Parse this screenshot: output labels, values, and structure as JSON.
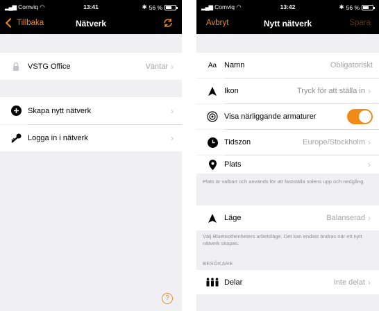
{
  "left": {
    "status": {
      "carrier": "Comviq",
      "time": "13:41",
      "battery": "56 %"
    },
    "nav": {
      "back_label": "Tillbaka",
      "title": "Nätverk",
      "refresh_icon": "refresh-icon"
    },
    "networks": [
      {
        "name": "VSTG Office",
        "status": "Väntar",
        "icon": "lock-icon"
      }
    ],
    "actions": [
      {
        "label": "Skapa nytt nätverk",
        "icon": "plus-circle-icon"
      },
      {
        "label": "Logga in i nätverk",
        "icon": "key-icon"
      }
    ],
    "help_label": "?"
  },
  "right": {
    "status": {
      "carrier": "Comviq",
      "time": "13:42",
      "battery": "56 %"
    },
    "nav": {
      "cancel_label": "Avbryt",
      "title": "Nytt nätverk",
      "save_label": "Spara"
    },
    "rows": {
      "name": {
        "label": "Namn",
        "placeholder": "Obligatoriskt",
        "icon_text": "Aa"
      },
      "icon": {
        "label": "Ikon",
        "value": "Tryck för att ställa in"
      },
      "nearby": {
        "label": "Visa närliggande armaturer",
        "enabled": true
      },
      "timezone": {
        "label": "Tidszon",
        "value": "Europe/Stockholm"
      },
      "location": {
        "label": "Plats",
        "value": ""
      },
      "mode": {
        "label": "Läge",
        "value": "Balanserad"
      },
      "share": {
        "label": "Delar",
        "value": "Inte delat"
      }
    },
    "location_note": "Plats är valbart och används för att fastställa solens upp och nedgång.",
    "mode_note": "Välj Bluetoothenheters arbetsläge. Det kan endast ändras när ett nytt nätverk skapas.",
    "visitors_header": "BESÖKARE"
  },
  "colors": {
    "accent": "#f08a17",
    "background": "#efeff4",
    "secondary_text": "#a5a5a9"
  }
}
